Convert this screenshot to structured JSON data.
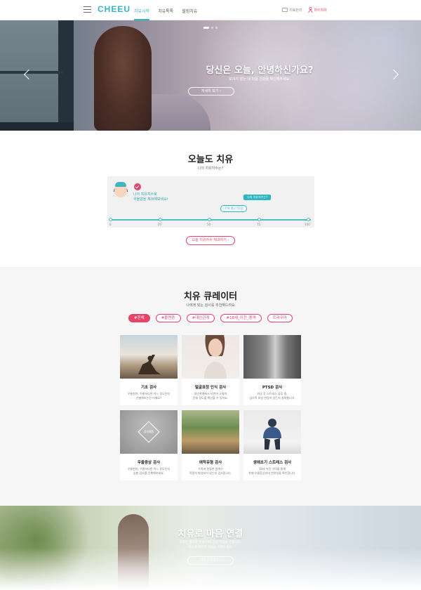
{
  "header": {
    "logo": "CHEEU",
    "nav": [
      "치유시작",
      "치유톡톡",
      "힐링치유"
    ],
    "util_left": "치료관리",
    "util_right": "마이치유"
  },
  "hero": {
    "title": "당신은 오늘, 안녕하신가요?",
    "subtitle": "보이지 않는 내 마음 건강을 확인해주세요.",
    "button": "자세히 보기"
  },
  "today": {
    "title": "오늘도 치유",
    "subtitle": "나의 치유지수는?",
    "msg1": "나의 치유지수로",
    "msg2": "우울감을 체크해보세요!",
    "my_score_label": "나의 치유지수는?",
    "avg_label": "전체 평균 55점",
    "scale": [
      "0",
      "25",
      "50",
      "75",
      "100"
    ],
    "button": "오늘 치유지수 체크하기"
  },
  "curator": {
    "title": "치유 큐레이터",
    "subtitle": "나에게 맞는 검사를 추천해드려요",
    "tags": [
      "#전체",
      "#불면증",
      "#대인관계",
      "#18세_이전_충격",
      "트라우마"
    ],
    "cards": [
      {
        "title": "기초 검사",
        "desc1": "우울한지, 우울하다면 어느 정도인지",
        "desc2": "선별해보는건 어때요?"
      },
      {
        "title": "얼굴표정 인식 검사",
        "desc1": "대인관계에서 비언어 소통의",
        "desc2": "문제 정도를 확인할 수 있어요."
      },
      {
        "title": "PTSD 검사",
        "desc1": "외상 후 스트레스 증후 중,",
        "desc2": "심리적 외상 반응이 있는지 살펴봅니다."
      },
      {
        "title": "우울증상 검사",
        "desc1": "우울한지, 우울하다면 어느 정도인지",
        "desc2": "심층 검사를 진행해보세요."
      },
      {
        "title": "애착유형 검사",
        "desc1": "가족과 친밀한 관계가",
        "desc2": "적절히 형성되어 있는지 검사합니다."
      },
      {
        "title": "생애초기 스트레스 검사",
        "desc1": "18세 이전 기억을 통해",
        "desc2": "현재 우울증상과의 연관성을 확인합니다."
      }
    ],
    "overlay_label": "검사예정"
  },
  "connect": {
    "title": "치유로 마음 연결",
    "sub1": "치유는 필요한 분께 나의 진심 마음을 전합니다.",
    "sub2": "마음에 따뜻한 마음을 전해보세요.",
    "button": "치유 응원하기"
  },
  "colors": {
    "accent": "#2db6c1",
    "pink": "#e8436b"
  }
}
